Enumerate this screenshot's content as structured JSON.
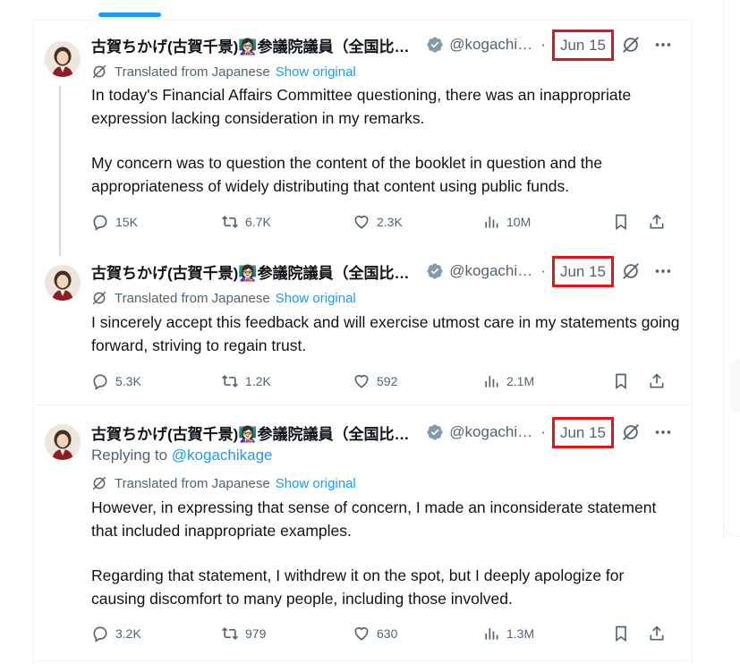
{
  "author": {
    "name": "古賀ちかげ(古賀千景)👩🏻‍🏫参議院議員（全国比例）",
    "handle": "@kogachikage"
  },
  "icons": {
    "verified": "verified-badge-icon",
    "grok": "grok-icon",
    "more": "more-icon",
    "translate": "translate-icon",
    "reply": "reply-icon",
    "retweet": "retweet-icon",
    "like": "heart-icon",
    "views": "views-chart-icon",
    "bookmark": "bookmark-icon",
    "share": "share-icon"
  },
  "colors": {
    "accent": "#1d9bf0",
    "highlight_box": "#e0161c",
    "secondary_text": "#536471"
  },
  "tweets": [
    {
      "date": "Jun 15",
      "translated_label": "Translated from Japanese",
      "show_original": "Show original",
      "paragraphs": [
        "In today's Financial Affairs Committee questioning, there was an inappropriate expression lacking consideration in my remarks.",
        "My concern was to question the content of the booklet in question and the appropriateness of widely distributing that content using public funds."
      ],
      "stats": {
        "replies": "15K",
        "reposts": "6.7K",
        "likes": "2.3K",
        "views": "10M"
      }
    },
    {
      "date": "Jun 15",
      "translated_label": "Translated from Japanese",
      "show_original": "Show original",
      "paragraphs": [
        "I sincerely accept this feedback and will exercise utmost care in my statements going forward, striving to regain trust."
      ],
      "stats": {
        "replies": "5.3K",
        "reposts": "1.2K",
        "likes": "592",
        "views": "2.1M"
      }
    },
    {
      "date": "Jun 15",
      "replying_prefix": "Replying to",
      "replying_handle": "@kogachikage",
      "translated_label": "Translated from Japanese",
      "show_original": "Show original",
      "paragraphs": [
        "However, in expressing that sense of concern, I made an inconsiderate statement that included inappropriate examples.",
        "Regarding that statement, I withdrew it on the spot, but I deeply apologize for causing discomfort to many people, including those involved."
      ],
      "stats": {
        "replies": "3.2K",
        "reposts": "979",
        "likes": "630",
        "views": "1.3M"
      }
    }
  ]
}
